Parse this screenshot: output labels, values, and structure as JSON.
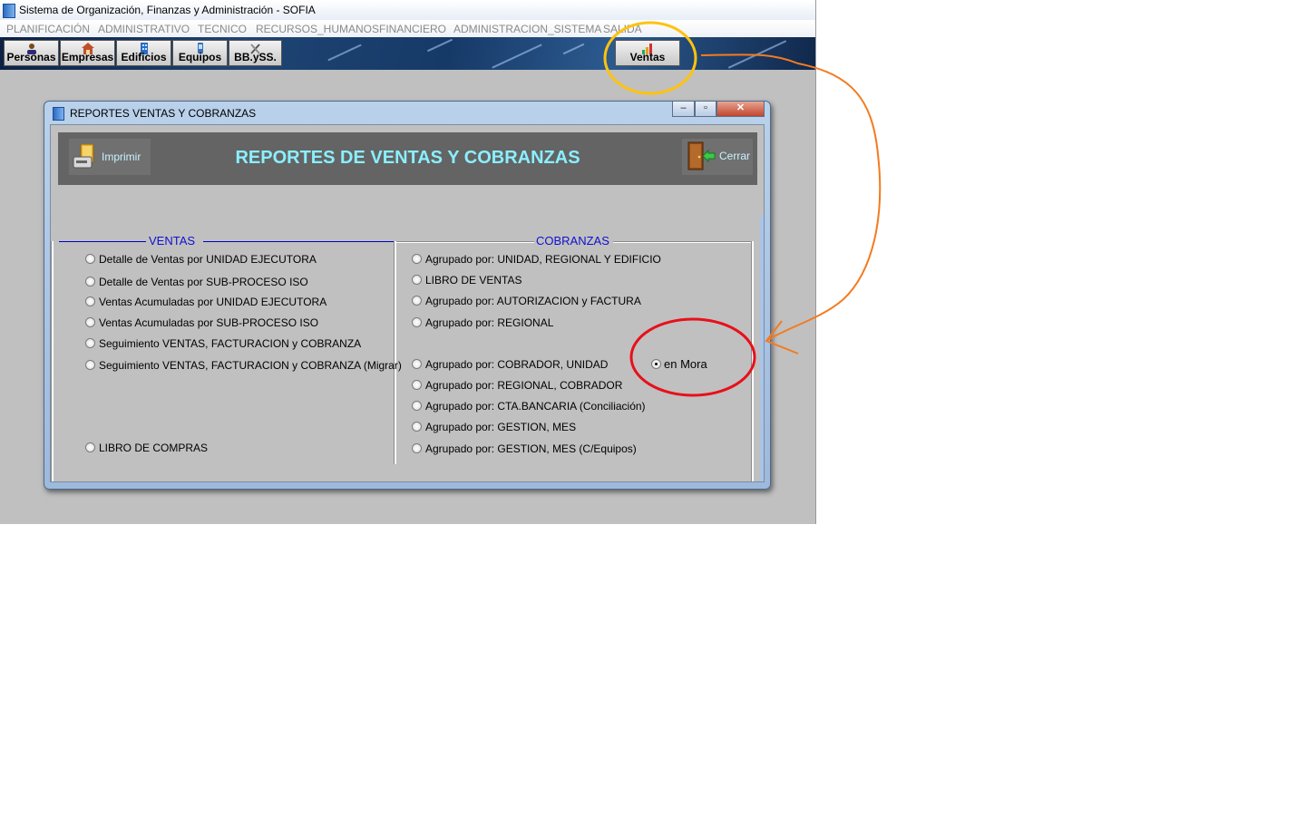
{
  "app": {
    "title": "Sistema de Organización, Finanzas y Administración - SOFIA",
    "menu": [
      "PLANIFICACIÓN",
      "ADMINISTRATIVO",
      "TECNICO",
      "RECURSOS_HUMANOS",
      "FINANCIERO",
      "ADMINISTRACION_SISTEMA",
      "SALIDA"
    ],
    "toolbar": [
      "Personas",
      "Empresas",
      "Edificios",
      "Equipos",
      "BB.ySS.",
      "Ventas"
    ]
  },
  "dialog": {
    "title": "REPORTES VENTAS Y COBRANZAS",
    "header_title": "REPORTES DE VENTAS Y COBRANZAS",
    "print_label": "Imprimir",
    "close_label": "Cerrar",
    "ventas": {
      "label": "VENTAS",
      "options": [
        "Detalle de Ventas por UNIDAD EJECUTORA",
        "Detalle de Ventas por SUB-PROCESO ISO",
        "Ventas Acumuladas por UNIDAD EJECUTORA",
        "Ventas Acumuladas por SUB-PROCESO ISO",
        "Seguimiento VENTAS, FACTURACION y COBRANZA",
        "Seguimiento VENTAS, FACTURACION y COBRANZA (Migrar)"
      ],
      "libro_compras": "LIBRO DE COMPRAS"
    },
    "cobranzas": {
      "label": "COBRANZAS",
      "options": [
        "Agrupado por: UNIDAD, REGIONAL Y EDIFICIO",
        "LIBRO DE VENTAS",
        "Agrupado por: AUTORIZACION y FACTURA",
        "Agrupado por: REGIONAL",
        "Agrupado por: COBRADOR, UNIDAD",
        "Agrupado por: REGIONAL, COBRADOR",
        "Agrupado por: CTA.BANCARIA (Conciliación)",
        "Agrupado por: GESTION, MES",
        "Agrupado por: GESTION, MES (C/Equipos)"
      ],
      "en_mora": "en Mora"
    }
  },
  "colors": {
    "annotation_circle_ventas": "#ffc20e",
    "annotation_circle_mora": "#e8101a",
    "annotation_arrow": "#f47b20"
  }
}
